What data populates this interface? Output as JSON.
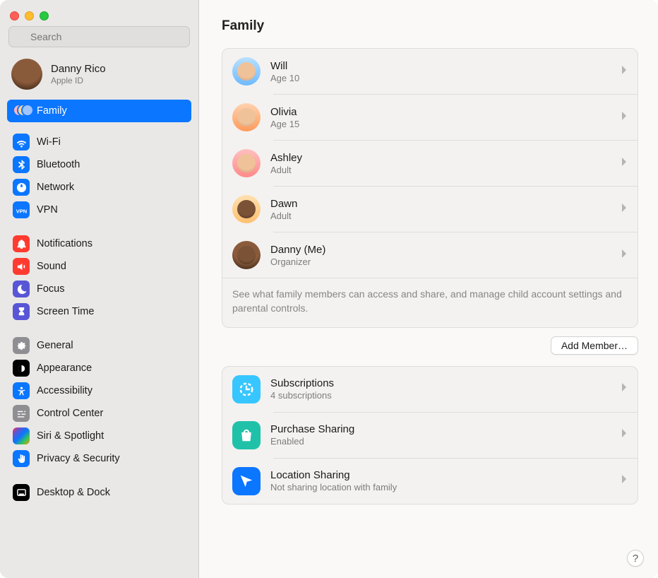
{
  "search": {
    "placeholder": "Search"
  },
  "profile": {
    "name": "Danny Rico",
    "sub": "Apple ID"
  },
  "sidebar": {
    "family_label": "Family",
    "groups": [
      [
        {
          "label": "Wi-Fi",
          "icon": "wifi",
          "color": "blue"
        },
        {
          "label": "Bluetooth",
          "icon": "bluetooth",
          "color": "blue"
        },
        {
          "label": "Network",
          "icon": "globe",
          "color": "blue"
        },
        {
          "label": "VPN",
          "icon": "vpn",
          "color": "blue"
        }
      ],
      [
        {
          "label": "Notifications",
          "icon": "bell",
          "color": "red"
        },
        {
          "label": "Sound",
          "icon": "sound",
          "color": "red"
        },
        {
          "label": "Focus",
          "icon": "moon",
          "color": "purple"
        },
        {
          "label": "Screen Time",
          "icon": "hourglass",
          "color": "purple"
        }
      ],
      [
        {
          "label": "General",
          "icon": "gear",
          "color": "gray"
        },
        {
          "label": "Appearance",
          "icon": "appear",
          "color": "black"
        },
        {
          "label": "Accessibility",
          "icon": "access",
          "color": "blue"
        },
        {
          "label": "Control Center",
          "icon": "sliders",
          "color": "gray"
        },
        {
          "label": "Siri & Spotlight",
          "icon": "siri",
          "color": "multi"
        },
        {
          "label": "Privacy & Security",
          "icon": "hand",
          "color": "blue"
        }
      ],
      [
        {
          "label": "Desktop & Dock",
          "icon": "dock",
          "color": "black"
        }
      ]
    ]
  },
  "page": {
    "title": "Family",
    "members": [
      {
        "name": "Will",
        "sub": "Age 10",
        "avatar": "av-blue"
      },
      {
        "name": "Olivia",
        "sub": "Age 15",
        "avatar": "av-orange"
      },
      {
        "name": "Ashley",
        "sub": "Adult",
        "avatar": "av-pink"
      },
      {
        "name": "Dawn",
        "sub": "Adult",
        "avatar": "av-peach",
        "face": "dark"
      },
      {
        "name": "Danny (Me)",
        "sub": "Organizer",
        "avatar": "av-dark",
        "face": "dark"
      }
    ],
    "note": "See what family members can access and share, and manage child account settings and parental controls.",
    "add_label": "Add Member…",
    "services": [
      {
        "name": "Subscriptions",
        "sub": "4 subscriptions",
        "icon": "subs",
        "color": "sky"
      },
      {
        "name": "Purchase Sharing",
        "sub": "Enabled",
        "icon": "bag",
        "color": "teal"
      },
      {
        "name": "Location Sharing",
        "sub": "Not sharing location with family",
        "icon": "location",
        "color": "blue"
      }
    ],
    "help": "?"
  }
}
